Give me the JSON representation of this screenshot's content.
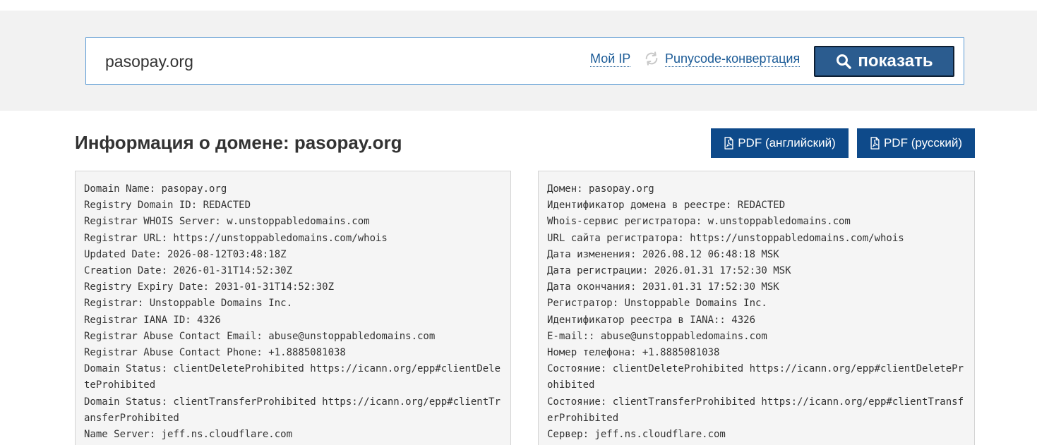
{
  "search": {
    "value": "pasopay.org",
    "my_ip_label": "Мой IP",
    "punycode_label": "Punycode-конвертация",
    "show_button_label": "показать"
  },
  "header": {
    "title_prefix": "Информация о домене: ",
    "title_domain": "pasopay.org",
    "pdf_en_label": "PDF (английский)",
    "pdf_ru_label": "PDF (русский)"
  },
  "colors": {
    "accent": "#0e4a8a",
    "link": "#1a5a96",
    "show_button": "#2b5c8f",
    "band_bg": "#f2f2f2",
    "panel_bg": "#f5f5f5"
  },
  "icons": {
    "refresh": "refresh-icon",
    "search": "search-icon",
    "pdf": "pdf-file-icon"
  },
  "whois_en": [
    "Domain Name: pasopay.org",
    "Registry Domain ID: REDACTED",
    "Registrar WHOIS Server: w.unstoppabledomains.com",
    "Registrar URL: https://unstoppabledomains.com/whois",
    "Updated Date: 2026-08-12T03:48:18Z",
    "Creation Date: 2026-01-31T14:52:30Z",
    "Registry Expiry Date: 2031-01-31T14:52:30Z",
    "Registrar: Unstoppable Domains Inc.",
    "Registrar IANA ID: 4326",
    "Registrar Abuse Contact Email: abuse@unstoppabledomains.com",
    "Registrar Abuse Contact Phone: +1.8885081038",
    "Domain Status: clientDeleteProhibited https://icann.org/epp#clientDeleteProhibited",
    "Domain Status: clientTransferProhibited https://icann.org/epp#clientTransferProhibited",
    "Name Server: jeff.ns.cloudflare.com"
  ],
  "whois_ru": [
    "Домен: pasopay.org",
    "Идентификатор домена в реестре: REDACTED",
    "Whois-сервис регистратора: w.unstoppabledomains.com",
    "URL сайта регистратора: https://unstoppabledomains.com/whois",
    "Дата изменения: 2026.08.12 06:48:18 MSK",
    "Дата регистрации: 2026.01.31 17:52:30 MSK",
    "Дата окончания: 2031.01.31 17:52:30 MSK",
    "Регистратор: Unstoppable Domains Inc.",
    "Идентификатор реестра в IANA:: 4326",
    "E-mail:: abuse@unstoppabledomains.com",
    "Номер телефона: +1.8885081038",
    "Состояние: clientDeleteProhibited https://icann.org/epp#clientDeleteProhibited",
    "Состояние: clientTransferProhibited https://icann.org/epp#clientTransferProhibited",
    "Сервер: jeff.ns.cloudflare.com"
  ]
}
